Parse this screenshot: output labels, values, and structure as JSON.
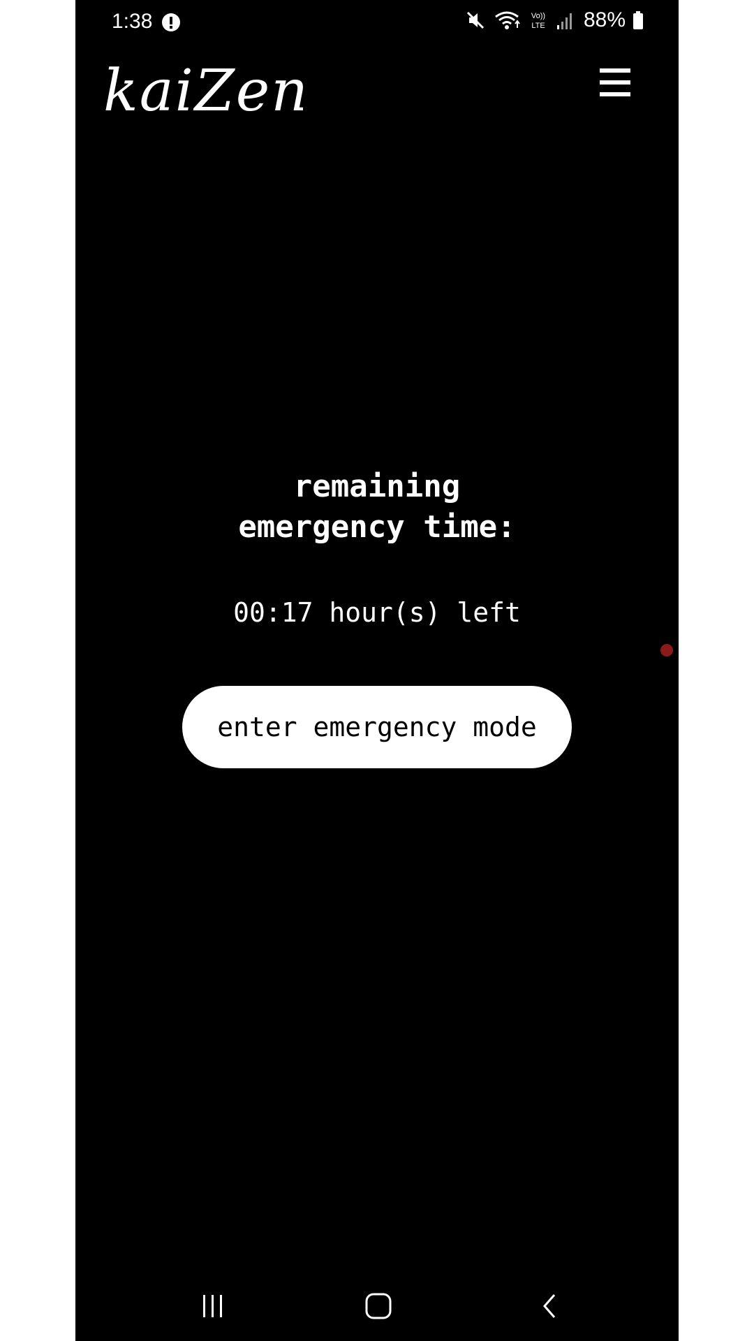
{
  "status_bar": {
    "time": "1:38",
    "battery_percent": "88%",
    "icons": [
      "alert-icon",
      "mute-icon",
      "wifi-icon",
      "volte-icon",
      "signal-icon",
      "battery-icon"
    ]
  },
  "header": {
    "logo_text": "kaiZen",
    "menu_icon": "hamburger-menu-icon"
  },
  "main": {
    "heading_line1": "remaining",
    "heading_line2": "emergency time:",
    "time_left": "00:17 hour(s) left",
    "button_label": "enter emergency mode"
  },
  "nav_bar": {
    "icons": [
      "recents-icon",
      "home-icon",
      "back-icon"
    ]
  },
  "colors": {
    "background": "#000000",
    "text": "#ffffff",
    "button_bg": "#ffffff",
    "button_text": "#000000",
    "indicator_dot": "#8b1a1a"
  }
}
